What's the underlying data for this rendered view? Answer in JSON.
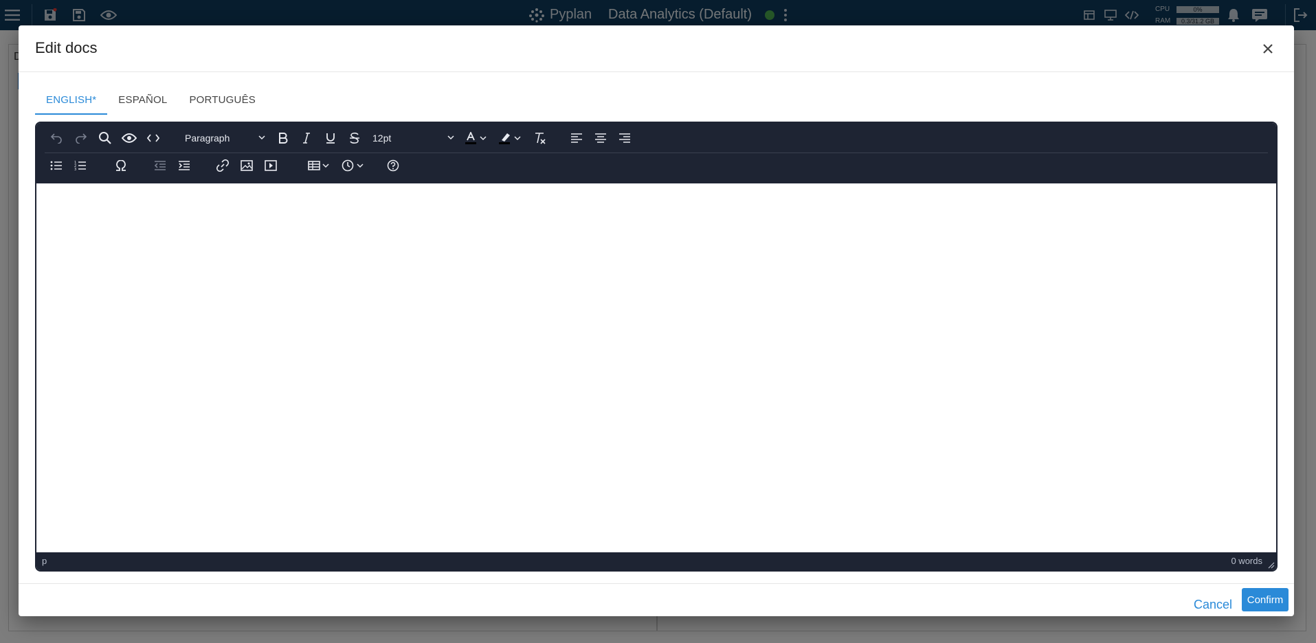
{
  "topbar": {
    "app_name": "Pyplan",
    "project_title": "Data Analytics (Default)",
    "cpu_label": "CPU",
    "cpu_value": "0%",
    "ram_label": "RAM",
    "ram_value": "0.3/31.2 GB",
    "status_color": "#4caf50"
  },
  "background": {
    "panel_letter": "D"
  },
  "dialog": {
    "title": "Edit docs",
    "tabs": [
      {
        "label": "ENGLISH*",
        "active": true
      },
      {
        "label": "ESPAÑOL",
        "active": false
      },
      {
        "label": "PORTUGUÊS",
        "active": false
      }
    ],
    "editor": {
      "block_format": "Paragraph",
      "font_size": "12pt",
      "status_path": "p",
      "word_count": "0 words"
    },
    "cancel_label": "Cancel",
    "confirm_label": "Confirm"
  },
  "colors": {
    "accent": "#2a8ad8",
    "topbar_bg": "#0f3a5c",
    "editor_chrome": "#1e2433"
  }
}
